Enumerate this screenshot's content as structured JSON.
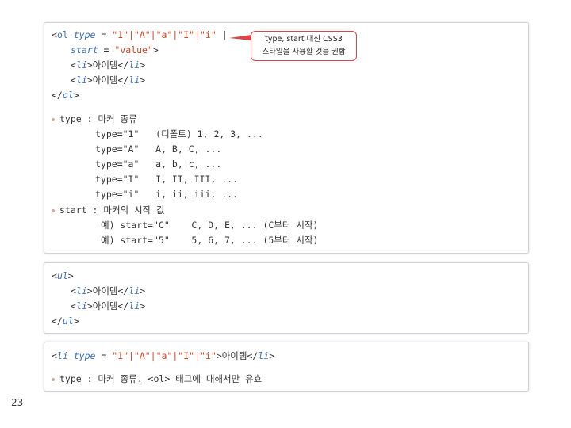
{
  "box1": {
    "ol_line": {
      "lt": "<",
      "tag": "ol",
      "sp1": " ",
      "attr": "type",
      "eq": " = ",
      "vals": "\"1\"|\"A\"|\"a\"|\"I\"|\"i\"",
      "end": " |"
    },
    "start_line": {
      "attr": "start",
      "eq": " = ",
      "val": "\"value\"",
      "close": ">"
    },
    "li1": {
      "open_lt": "<",
      "open_tag": "li",
      "open_gt": ">",
      "text": "아이템",
      "close_lt": "</",
      "close_tag": "li",
      "close_gt": ">"
    },
    "li2": {
      "open_lt": "<",
      "open_tag": "li",
      "open_gt": ">",
      "text": "아이템",
      "close_lt": "</",
      "close_tag": "li",
      "close_gt": ">"
    },
    "ol_close": {
      "lt": "</",
      "tag": "ol",
      "gt": ">"
    },
    "type_heading": "type : 마커 종류",
    "type_rows": [
      "type=\"1\"   (디폴트) 1, 2, 3, ...",
      "type=\"A\"   A, B, C, ...",
      "type=\"a\"   a, b, c, ...",
      "type=\"I\"   I, II, III, ...",
      "type=\"i\"   i, ii, iii, ..."
    ],
    "start_heading": "start : 마커의 시작 값",
    "start_rows": [
      "예) start=\"C\"    C, D, E, ... (C부터 시작)",
      "예) start=\"5\"    5, 6, 7, ... (5부터 시작)"
    ]
  },
  "callout": {
    "line1": "type, start 대신 CSS3",
    "line2": "스타일을 사용할 것을 권함"
  },
  "box2": {
    "ul_open": {
      "lt": "<",
      "tag": "ul",
      "gt": ">"
    },
    "li1": {
      "open_lt": "<",
      "open_tag": "li",
      "open_gt": ">",
      "text": "아이템",
      "close_lt": "</",
      "close_tag": "li",
      "close_gt": ">"
    },
    "li2": {
      "open_lt": "<",
      "open_tag": "li",
      "open_gt": ">",
      "text": "아이템",
      "close_lt": "</",
      "close_tag": "li",
      "close_gt": ">"
    },
    "ul_close": {
      "lt": "</",
      "tag": "ul",
      "gt": ">"
    }
  },
  "box3": {
    "li_line": {
      "lt": "<",
      "tag": "li",
      "sp": " ",
      "attr": "type",
      "eq": " = ",
      "vals": "\"1\"|\"A\"|\"a\"|\"I\"|\"i\"",
      "gt": ">",
      "text": "아이템",
      "close_lt": "</",
      "close_tag": "li",
      "close_gt": ">"
    },
    "note": "type : 마커 종류. <ol> 태그에 대해서만 유효"
  },
  "page_number": "23",
  "colors": {
    "tag": "#3b6db5",
    "string": "#c44a2a",
    "callout_border": "#dd4444",
    "box_border": "#cfd3d8"
  }
}
